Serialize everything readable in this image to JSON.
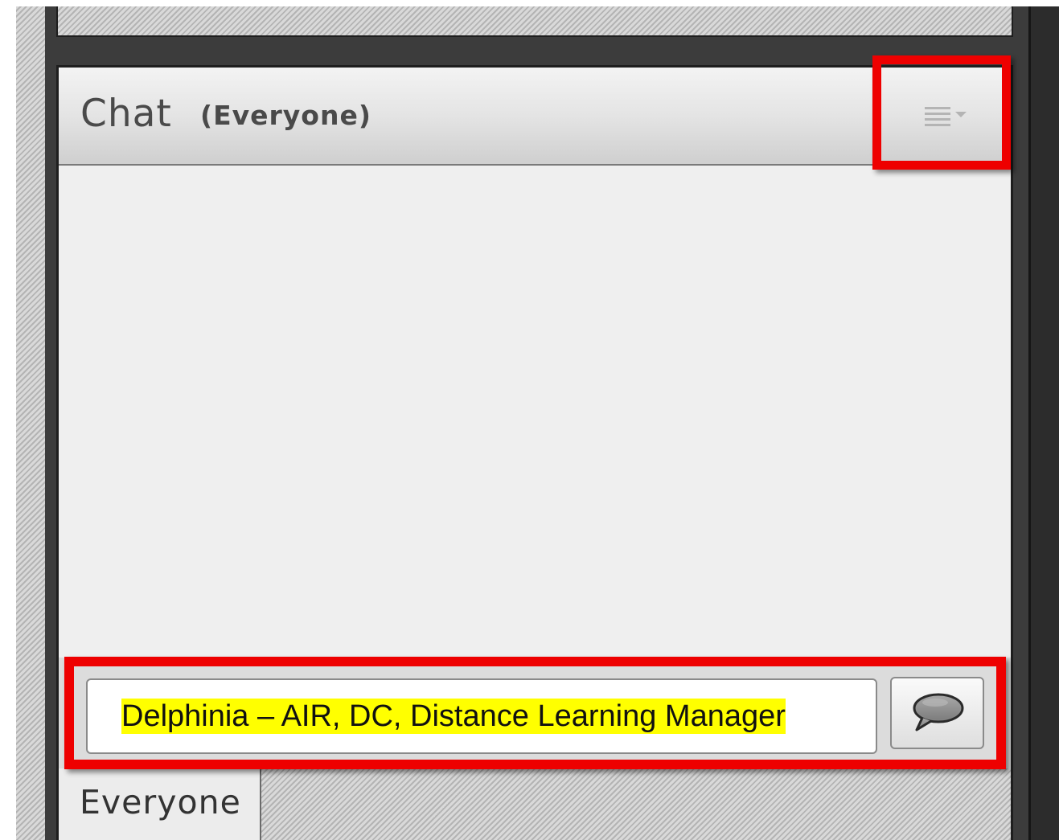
{
  "chat": {
    "title": "Chat",
    "subtitle": "(Everyone)",
    "options_icon": "menu-list-dropdown-icon"
  },
  "input": {
    "value": "Delphinia – AIR, DC, Distance Learning Manager",
    "send_icon": "speech-bubble-icon"
  },
  "tabs": [
    {
      "label": "Everyone",
      "active": true
    }
  ],
  "colors": {
    "highlight_box": "#ee0000",
    "text_highlight": "#ffff00",
    "frame": "#3c3c3c"
  }
}
